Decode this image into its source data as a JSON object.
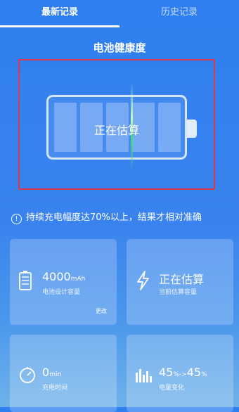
{
  "tabs": {
    "latest": "最新记录",
    "history": "历史记录"
  },
  "title": "电池健康度",
  "battery": {
    "status": "正在估算"
  },
  "notice": {
    "icon": "info-icon",
    "text": "持续充电幅度达70%以上，结果才相对准确"
  },
  "cards": [
    {
      "icon": "battery-icon",
      "value": "4000",
      "unit": "mAh",
      "label": "电池设计容量",
      "action": "更改"
    },
    {
      "icon": "lightning-icon",
      "value": "正在估算",
      "unit": "",
      "label": "当前估算容量"
    },
    {
      "icon": "timer-icon",
      "value": "0",
      "unit": "min",
      "label": "充电时间"
    },
    {
      "icon": "chart-icon",
      "value_from": "45",
      "unit_from": "%",
      "arrow": "->",
      "value_to": "45",
      "unit_to": "%",
      "label": "电量变化"
    }
  ],
  "colors": {
    "highlight_border": "#d93a4e",
    "scan_line": "#44e07a"
  }
}
